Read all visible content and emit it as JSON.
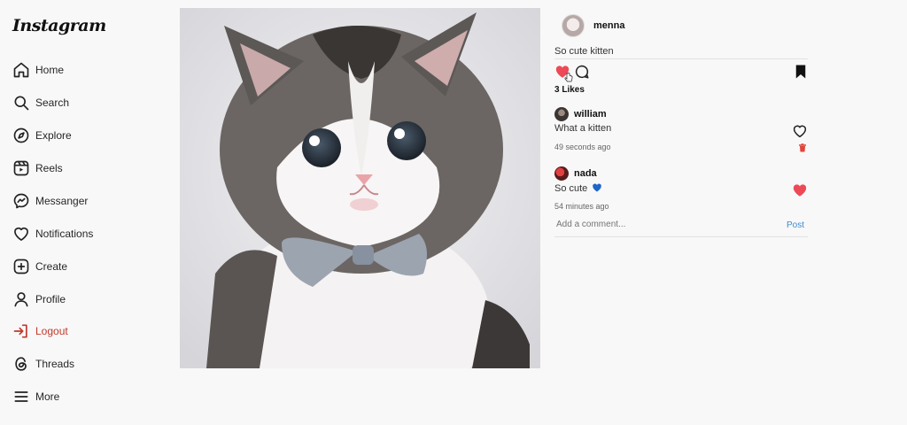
{
  "app": {
    "logo": "Instagram"
  },
  "sidebar": {
    "items": [
      {
        "label": "Home",
        "icon": "home-icon"
      },
      {
        "label": "Search",
        "icon": "search-icon"
      },
      {
        "label": "Explore",
        "icon": "compass-icon"
      },
      {
        "label": "Reels",
        "icon": "reels-icon"
      },
      {
        "label": "Messanger",
        "icon": "messenger-icon"
      },
      {
        "label": "Notifications",
        "icon": "heart-icon"
      },
      {
        "label": "Create",
        "icon": "plus-square-icon"
      },
      {
        "label": "Profile",
        "icon": "user-icon"
      },
      {
        "label": "Logout",
        "icon": "logout-icon"
      },
      {
        "label": "Threads",
        "icon": "threads-icon"
      },
      {
        "label": "More",
        "icon": "menu-icon"
      }
    ]
  },
  "post": {
    "author": "menna",
    "caption": "So cute kitten",
    "likes": "3 Likes",
    "liked": true,
    "saved": true,
    "colors": {
      "like": "#ed4956",
      "post_link": "#3d8bd4",
      "logout": "#c0392b"
    }
  },
  "comments": [
    {
      "user": "william",
      "text": "What a kitten",
      "time": "49 seconds ago",
      "liked": false,
      "deletable": true
    },
    {
      "user": "nada",
      "text": "So cute",
      "emoji": "blue-heart",
      "time": "54 minutes ago",
      "liked": true,
      "deletable": false
    }
  ],
  "comment_box": {
    "placeholder": "Add a comment...",
    "post_label": "Post"
  }
}
